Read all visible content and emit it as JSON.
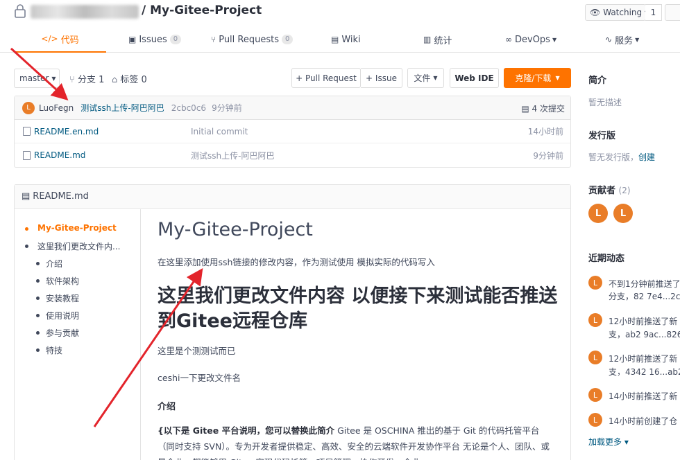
{
  "header": {
    "repo_name": "/ My-Gitee-Project",
    "watch_label": "Watching",
    "watch_count": "1"
  },
  "nav": {
    "tabs": [
      {
        "label": "代码",
        "icon": "code-icon"
      },
      {
        "label": "Issues",
        "badge": "0",
        "icon": "issues-icon"
      },
      {
        "label": "Pull Requests",
        "badge": "0",
        "icon": "pull-request-icon"
      },
      {
        "label": "Wiki",
        "icon": "book-icon"
      },
      {
        "label": "统计",
        "icon": "chart-icon"
      },
      {
        "label": "DevOps",
        "icon": "infinity-icon"
      },
      {
        "label": "服务",
        "icon": "pulse-icon"
      }
    ]
  },
  "toolbar": {
    "branch": "master",
    "branches": "分支 1",
    "tags": "标签 0",
    "pull_request": "+ Pull Request",
    "issue": "+ Issue",
    "file_menu": "文件",
    "web_ide": "Web IDE",
    "clone": "克隆/下载"
  },
  "commit": {
    "avatar_letter": "L",
    "author": "LuoFegn",
    "message": "测试ssh上传-阿巴阿巴",
    "hash": "2cbc0c6",
    "time": "9分钟前",
    "count": "4 次提交"
  },
  "files": [
    {
      "name": "README.en.md",
      "message": "Initial commit",
      "time": "14小时前"
    },
    {
      "name": "README.md",
      "message": "测试ssh上传-阿巴阿巴",
      "time": "9分钟前"
    }
  ],
  "readme": {
    "header": "README.md",
    "toc": [
      "My-Gitee-Project",
      "这里我们更改文件内...",
      "介绍",
      "软件架构",
      "安装教程",
      "使用说明",
      "参与贡献",
      "特技"
    ],
    "h1": "My-Gitee-Project",
    "p1": "在这里添加使用ssh链接的修改内容，作为测试使用 模拟实际的代码写入",
    "h2": "这里我们更改文件内容 以便接下来测试能否推送到Gitee远程仓库",
    "p2": "这里是个测测试而已",
    "p3": "ceshi一下更改文件名",
    "h3": "介绍",
    "p4_bold": "{以下是 Gitee 平台说明，您可以替换此简介",
    "p4_rest": " Gitee 是 OSCHINA 推出的基于 Git 的代码托管平台（同时支持 SVN）。专为开发者提供稳定、高效、安全的云端软件开发协作平台 无论是个人、团队、或是企业，都能够用 Gitee 实现代码托管、项目管理、协作开发。企业"
  },
  "sidebar": {
    "intro_title": "简介",
    "intro_text": "暂无描述",
    "release_title": "发行版",
    "release_text": "暂无发行版，",
    "release_link": "创建",
    "contrib_title": "贡献者",
    "contrib_count": "(2)",
    "contrib_avatars": [
      "L",
      "L"
    ],
    "activity_title": "近期动态",
    "feed": [
      {
        "line1": "不到1分钟前推送了",
        "line2": "分支，82   7e4...2c"
      },
      {
        "line1": "12小时前推送了新",
        "line2": "支，ab2  9ac...826"
      },
      {
        "line1": "12小时前推送了新",
        "line2": "支，4342  16...ab2"
      },
      {
        "line1": "14小时前推送了新",
        "line2": ""
      },
      {
        "line1": "14小时前创建了仓",
        "line2": ""
      }
    ],
    "load_more": "加载更多 ▾"
  }
}
